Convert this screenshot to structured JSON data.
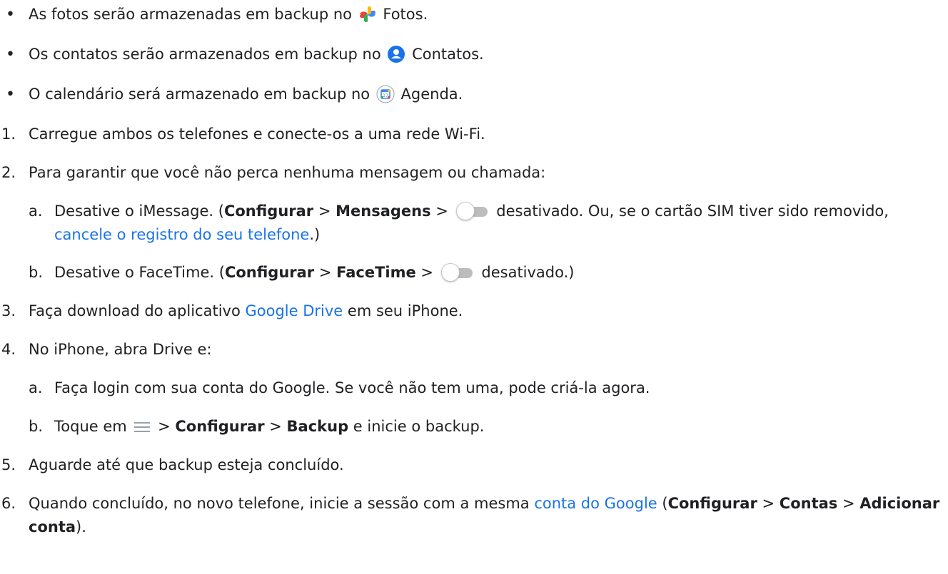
{
  "bullets": [
    {
      "text_before": "As fotos serão armazenadas em backup no",
      "app": "Fotos",
      "icon": "google-photos-icon"
    },
    {
      "text_before": "Os contatos serão armazenados em backup no",
      "app": "Contatos.",
      "icon": "google-contacts-icon"
    },
    {
      "text_before": "O calendário será armazenado em backup no",
      "app": "Agenda.",
      "icon": "google-calendar-icon"
    }
  ],
  "bullet_1_end": ".",
  "steps": {
    "s1": {
      "num": "1.",
      "text": "Carregue ambos os telefones e conecte-os a uma rede Wi-Fi."
    },
    "s2": {
      "num": "2.",
      "text": "Para garantir que você não perca nenhuma mensagem ou chamada:",
      "a": {
        "letter": "a.",
        "t1": "Desative o iMessage. (",
        "b1": "Configurar",
        "sep1": " > ",
        "b2": "Mensagens",
        "sep2": " > ",
        "t2": " desativado. Ou, se o cartão SIM tiver sido removido, ",
        "link": "cancele o registro do seu telefone",
        "t3": ".)"
      },
      "b": {
        "letter": "b.",
        "t1": "Desative o FaceTime. (",
        "b1": "Configurar",
        "sep1": " > ",
        "b2": "FaceTime",
        "sep2": " > ",
        "t2": " desativado.)"
      }
    },
    "s3": {
      "num": "3.",
      "t1": "Faça download do aplicativo ",
      "link": "Google Drive",
      "t2": " em seu iPhone."
    },
    "s4": {
      "num": "4.",
      "text": "No iPhone, abra Drive e:",
      "a": {
        "letter": "a.",
        "text": "Faça login com sua conta do Google. Se você não tem uma, pode criá-la agora."
      },
      "b": {
        "letter": "b.",
        "t1": "Toque em ",
        "sep1": " > ",
        "b1": "Configurar",
        "sep2": " > ",
        "b2": "Backup",
        "t2": " e inicie o backup."
      }
    },
    "s5": {
      "num": "5.",
      "text": "Aguarde até que backup esteja concluído."
    },
    "s6": {
      "num": "6.",
      "t1": "Quando concluído, no novo telefone, inicie a sessão com a mesma ",
      "link": "conta do Google",
      "t2": " (",
      "b1": "Configurar",
      "sep1": " >",
      "b2": "Contas",
      "sep2": " > ",
      "b3": "Adicionar conta",
      "t3": ")."
    }
  },
  "colors": {
    "link": "#1a73e8",
    "text": "#202124"
  }
}
